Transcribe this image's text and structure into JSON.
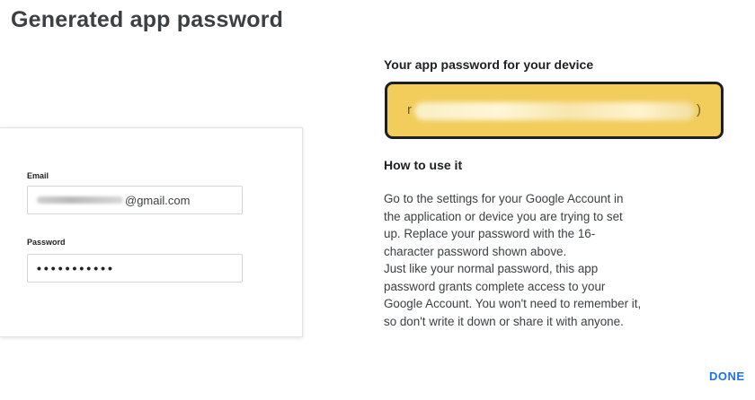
{
  "dialog": {
    "title": "Generated app password"
  },
  "login_example": {
    "email_label": "Email",
    "email_value": "@gmail.com",
    "password_label": "Password",
    "password_value": "•••••••••••"
  },
  "password_panel": {
    "heading": "Your app password for your device",
    "highlight_color": "#f2cd5c"
  },
  "instructions": {
    "heading": "How to use it",
    "lines": [
      "Go to the settings for your Google Account in",
      "the application or device you are trying to set",
      "up. Replace your password with the 16-",
      "character password shown above.",
      "Just like your normal password, this app",
      "password grants complete access to your",
      "Google Account. You won't need to remember it,",
      "so don't write it down or share it with anyone."
    ]
  },
  "actions": {
    "done_label": "DONE",
    "accent_color": "#1a73e8"
  }
}
